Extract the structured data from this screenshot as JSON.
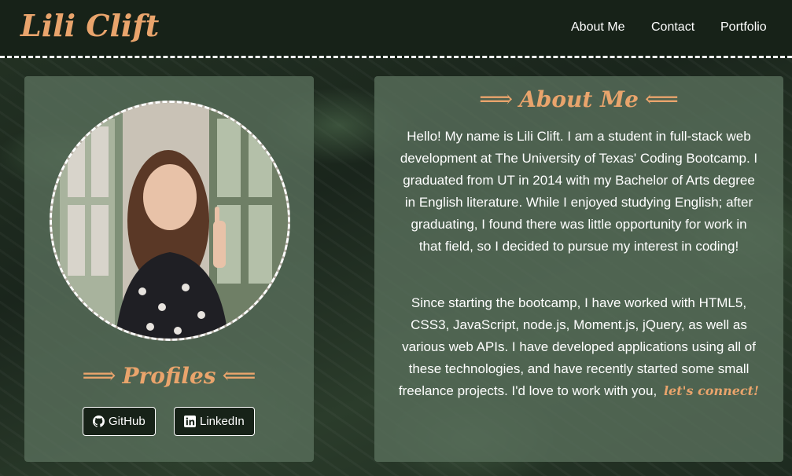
{
  "brand": {
    "name": "Lili Clift"
  },
  "nav": {
    "items": [
      {
        "label": "About Me"
      },
      {
        "label": "Contact"
      },
      {
        "label": "Portfolio"
      }
    ]
  },
  "profiles": {
    "heading": "Profiles",
    "left_arrow": "⟹",
    "right_arrow": "⟸",
    "github_label": "GitHub",
    "linkedin_label": "LinkedIn",
    "github_icon": "github-icon",
    "linkedin_icon": "linkedin-icon"
  },
  "about": {
    "heading": "About Me",
    "left_arrow": "⟹",
    "right_arrow": "⟸",
    "paragraph1": "Hello! My name is Lili Clift. I am a student in full-stack web development at The University of Texas' Coding Bootcamp. I graduated from UT in 2014 with my Bachelor of Arts degree in English literature. While I enjoyed studying English; after graduating, I found there was little opportunity for work in that field, so I decided to pursue my interest in coding!",
    "paragraph2": "Since starting the bootcamp, I have worked with HTML5, CSS3, JavaScript, node.js, Moment.js, jQuery, as well as various web APIs. I have developed applications using all of these technologies, and have recently started some small freelance projects. I'd love to work with you,",
    "connect_link": "let's connect!"
  },
  "colors": {
    "accent": "#e9a46c",
    "navbar": "#172218",
    "card": "#586e5a"
  }
}
